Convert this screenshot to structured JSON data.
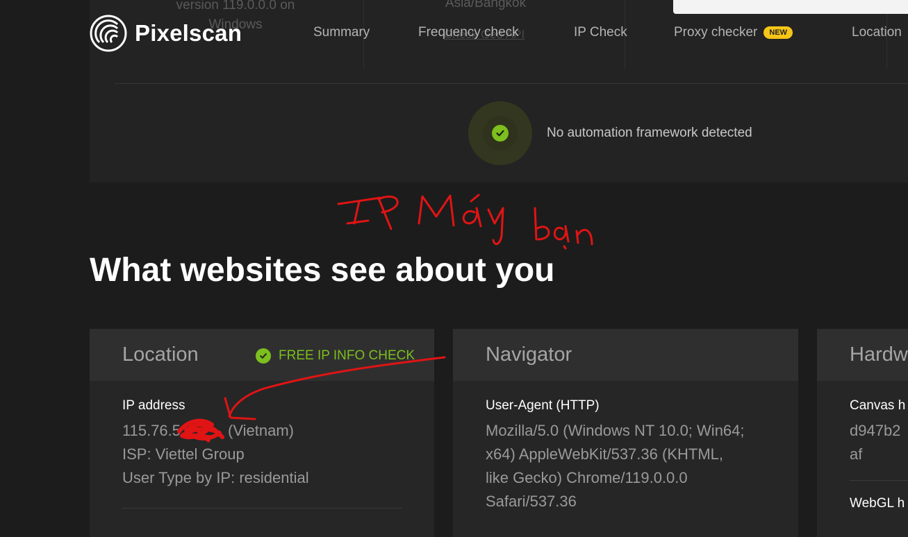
{
  "brand": {
    "name": "Pixelscan"
  },
  "nav": {
    "items": [
      "Summary",
      "Frequency check",
      "IP Check",
      "Proxy checker",
      "Location"
    ],
    "new_badge": "NEW"
  },
  "background_panel": {
    "browser_version": "version 119.0.0.0 on Windows",
    "timezone": "Asia/Bangkok",
    "link_text": "Check Geo API"
  },
  "automation": {
    "status_text": "No automation framework detected",
    "status_color": "#7cbf1e"
  },
  "annotation": {
    "handwritten_text": "IP Máy bạn",
    "ink_color": "#e01414"
  },
  "section": {
    "title": "What websites see about you"
  },
  "cards": {
    "location": {
      "title": "Location",
      "check_label": "FREE IP INFO CHECK",
      "ip_label": "IP address",
      "ip_value": "115.76.5",
      "ip_country": "(Vietnam)",
      "isp": "ISP: Viettel Group",
      "user_type": "User Type by IP: residential"
    },
    "navigator": {
      "title": "Navigator",
      "ua_label": "User-Agent (HTTP)",
      "ua_lines": [
        "Mozilla/5.0 (Windows NT 10.0; Win64;",
        "x64) AppleWebKit/537.36 (KHTML,",
        "like Gecko) Chrome/119.0.0.0",
        "Safari/537.36"
      ]
    },
    "hardware": {
      "title": "Hardw",
      "canvas_label": "Canvas h",
      "canvas_lines": [
        "d947b2",
        "af"
      ],
      "webgl_label": "WebGL h"
    }
  }
}
